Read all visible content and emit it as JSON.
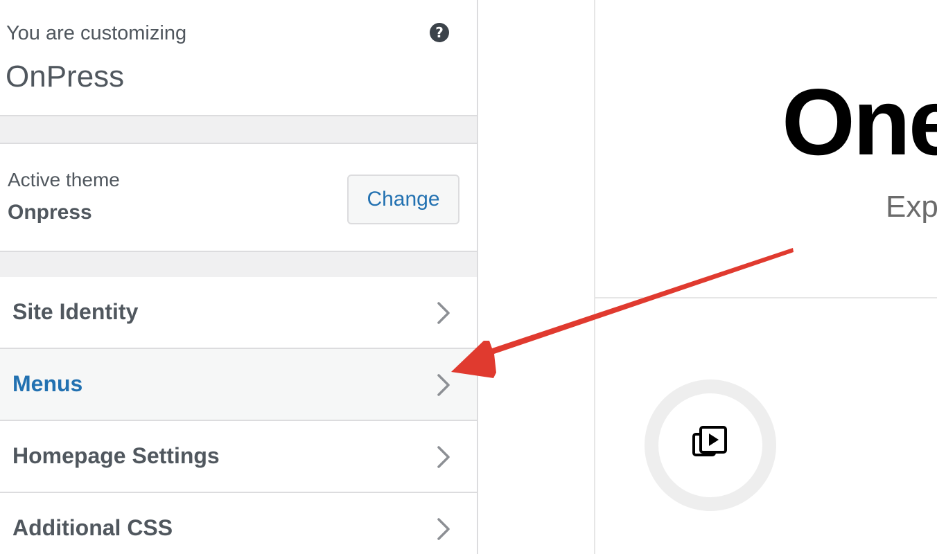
{
  "sidebar": {
    "info_label": "You are customizing",
    "info_title": "OnPress",
    "help_icon": "?",
    "theme_label": "Active theme",
    "theme_name": "Onpress",
    "change_label": "Change",
    "sections": [
      {
        "label": "Site Identity"
      },
      {
        "label": "Menus"
      },
      {
        "label": "Homepage Settings"
      },
      {
        "label": "Additional CSS"
      }
    ]
  },
  "preview": {
    "heading": "One",
    "subheading": "Exp"
  },
  "colors": {
    "accent": "#2271b1",
    "arrow": "#e03a2f"
  }
}
